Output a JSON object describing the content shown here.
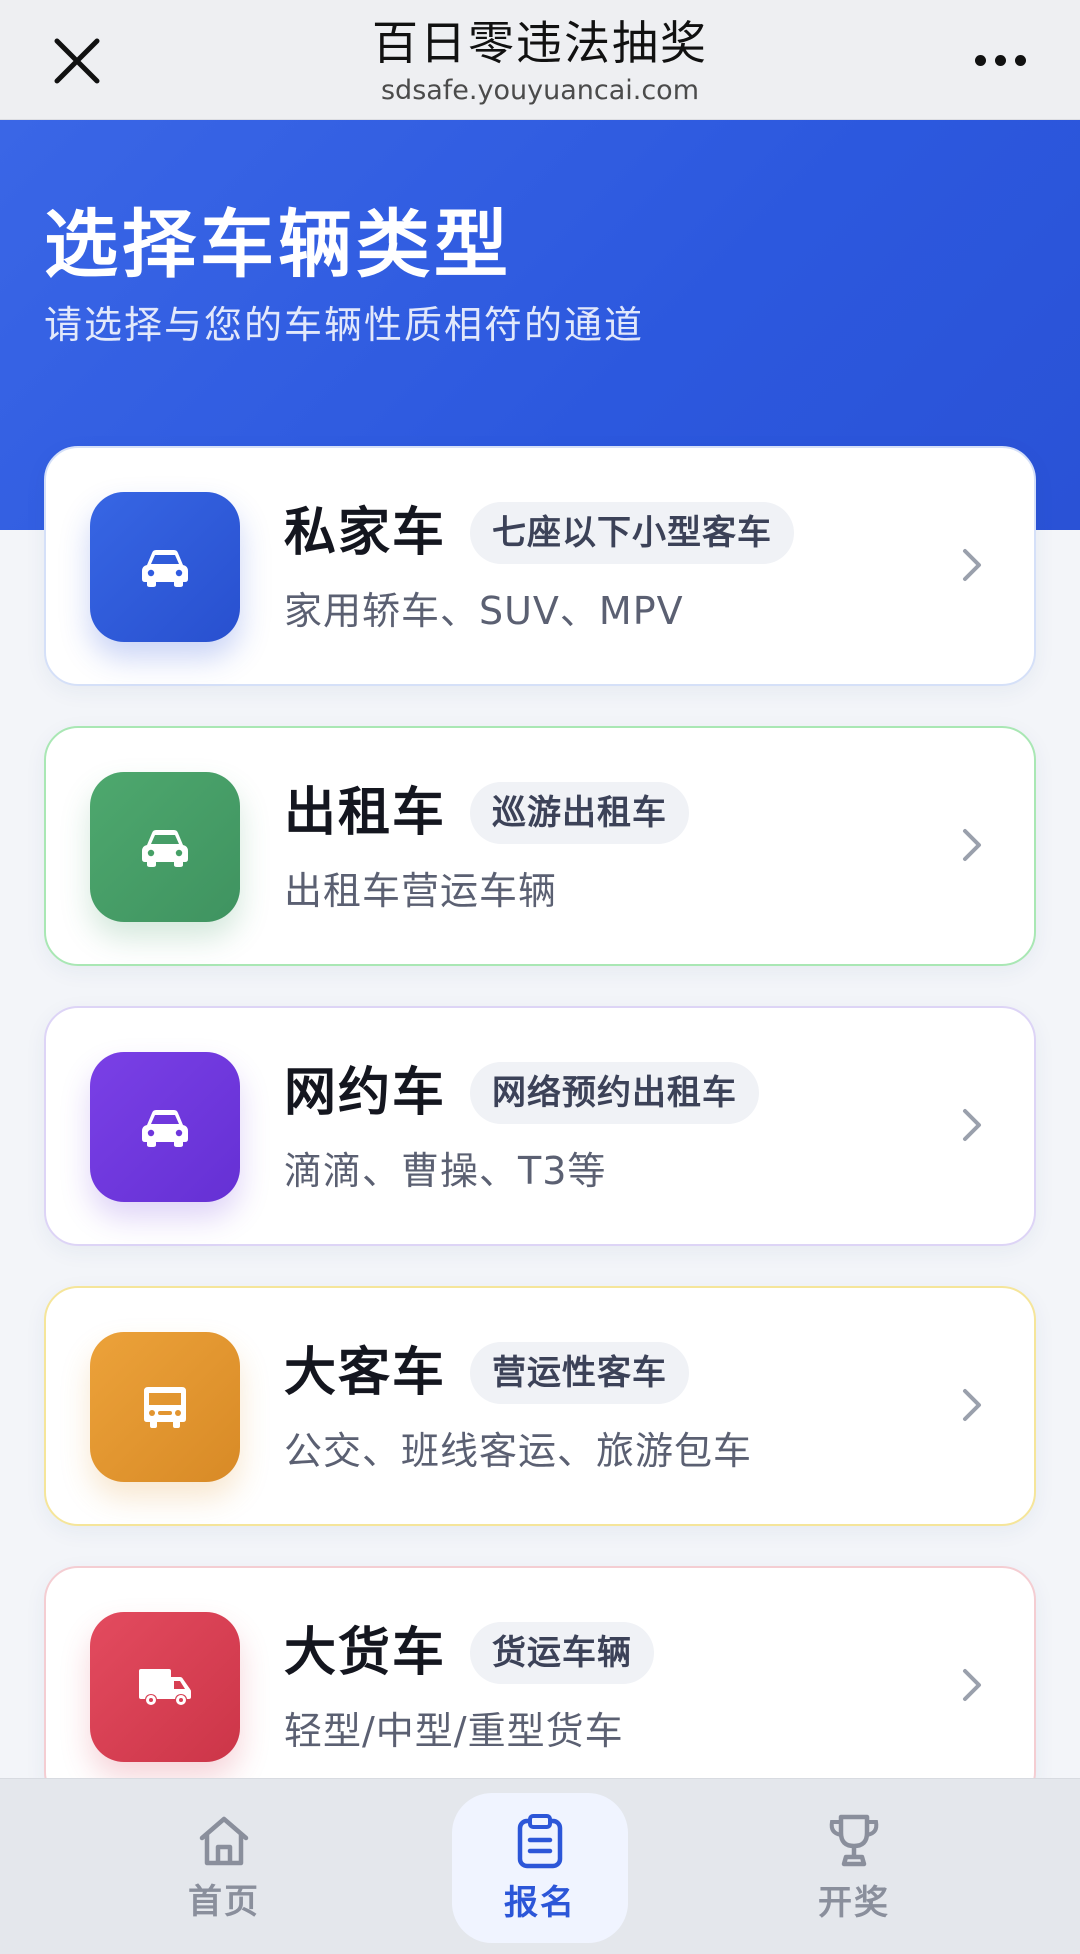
{
  "topbar": {
    "title": "百日零违法抽奖",
    "url": "sdsafe.youyuancai.com",
    "close_icon": "close-icon",
    "more_icon": "more-dots-icon"
  },
  "hero": {
    "heading": "选择车辆类型",
    "subheading": "请选择与您的车辆性质相符的通道"
  },
  "vehicles": [
    {
      "name": "私家车",
      "tag": "七座以下小型客车",
      "desc": "家用轿车、SUV、MPV",
      "icon": "car-icon",
      "color": "#2f5be0"
    },
    {
      "name": "出租车",
      "tag": "巡游出租车",
      "desc": "出租车营运车辆",
      "icon": "car-icon",
      "color": "#46a066"
    },
    {
      "name": "网约车",
      "tag": "网络预约出租车",
      "desc": "滴滴、曹操、T3等",
      "icon": "car-icon",
      "color": "#6e36dc"
    },
    {
      "name": "大客车",
      "tag": "营运性客车",
      "desc": "公交、班线客运、旅游包车",
      "icon": "bus-icon",
      "color": "#e29530"
    },
    {
      "name": "大货车",
      "tag": "货运车辆",
      "desc": "轻型/中型/重型货车",
      "icon": "truck-icon",
      "color": "#d94055"
    }
  ],
  "tabs": [
    {
      "label": "首页",
      "icon": "home-icon",
      "active": false
    },
    {
      "label": "报名",
      "icon": "clipboard-icon",
      "active": true
    },
    {
      "label": "开奖",
      "icon": "trophy-icon",
      "active": false
    }
  ],
  "colors": {
    "primary": "#2c58de",
    "tab_active": "#2c56d8",
    "tab_inactive": "#8a8f9c"
  }
}
